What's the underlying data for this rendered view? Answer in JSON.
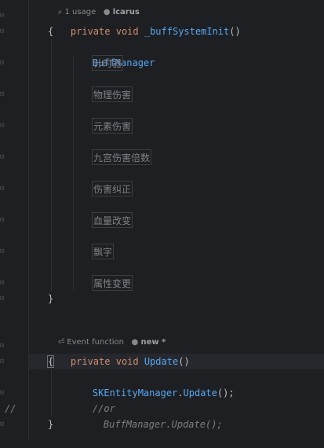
{
  "usages_hint": {
    "usage": "1 usage",
    "author": "lcarus"
  },
  "method1": {
    "keyword_private": "private",
    "keyword_void": "void",
    "name": "_buffSystemInit",
    "parens": "()",
    "open_brace": "{",
    "class_label": "BuffManager",
    "items": [
      "计时器",
      "物理伤害",
      "元素伤害",
      "九宫伤害倍数",
      "伤害纠正",
      "血量改变",
      "飘字",
      "属性变更"
    ],
    "close_brace": "}"
  },
  "hint2": {
    "event": "Event function",
    "author": "new *"
  },
  "method2": {
    "keyword_private": "private",
    "keyword_void": "void",
    "name": "Update",
    "parens": "()",
    "open_brace": "{",
    "line1_class": "SKEntityManager",
    "line1_dot": ".",
    "line1_call": "Update",
    "line1_tail": "();",
    "line2_comment": "//or",
    "line3_class": "BuffManager",
    "line3_dot": ".",
    "line3_call": "Update",
    "line3_tail": "();",
    "close_brace": "}"
  },
  "gutter_comment": "//"
}
